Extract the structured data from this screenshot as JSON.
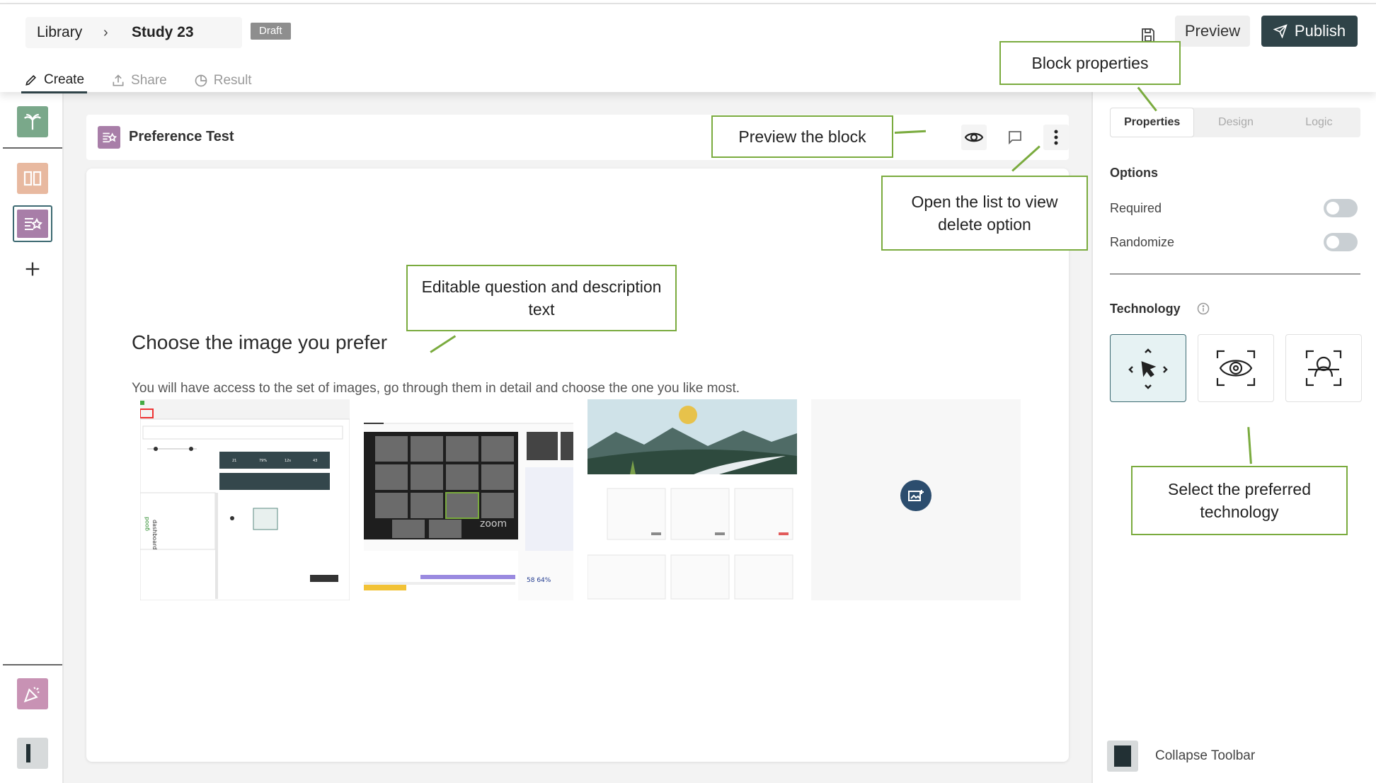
{
  "header": {
    "breadcrumb_library": "Library",
    "breadcrumb_sep": "›",
    "breadcrumb_study": "Study 23",
    "draft_badge": "Draft",
    "preview_label": "Preview",
    "publish_label": "Publish"
  },
  "mode_tabs": [
    {
      "label": "Create",
      "icon": "pencil-icon",
      "active": true
    },
    {
      "label": "Share",
      "icon": "share-icon",
      "active": false
    },
    {
      "label": "Result",
      "icon": "pie-chart-icon",
      "active": false
    }
  ],
  "block": {
    "title": "Preference Test",
    "question": "Choose the image you prefer",
    "description": "You will have access to the set of images, go through them in detail and choose the one you like most."
  },
  "properties": {
    "tabs": [
      {
        "label": "Properties",
        "active": true
      },
      {
        "label": "Design",
        "active": false
      },
      {
        "label": "Logic",
        "active": false
      }
    ],
    "options_heading": "Options",
    "required_label": "Required",
    "randomize_label": "Randomize",
    "technology_heading": "Technology",
    "technology_options": [
      "cursor-tracking-icon",
      "eye-tracking-icon",
      "face-tracking-icon"
    ],
    "collapse_label": "Collapse Toolbar"
  },
  "annotations": {
    "block_properties": "Block properties",
    "preview_block": "Preview the block",
    "delete_option": "Open the list to view delete option",
    "editable_text": "Editable question and description text",
    "select_technology": "Select the preferred technology"
  },
  "colors": {
    "accent_dark": "#2f4348",
    "callout_border": "#7aab3e",
    "block_icon": "#a87ea8",
    "rail_green": "#7aa88a",
    "rail_peach": "#e8b9a0"
  }
}
